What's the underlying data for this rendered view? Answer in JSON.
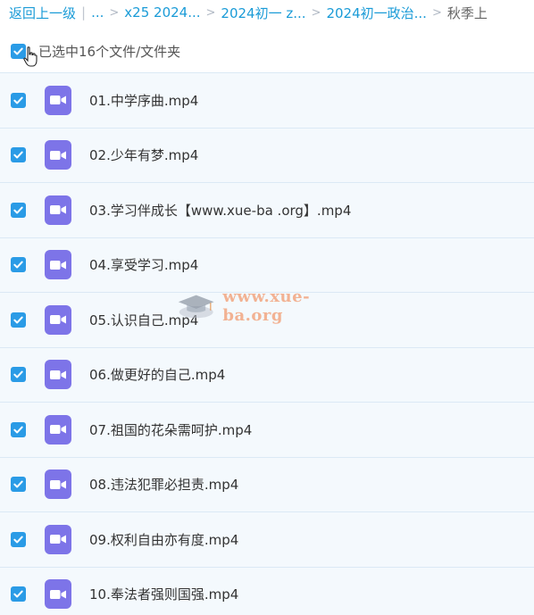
{
  "breadcrumb": {
    "back": "返回上一级",
    "ellipsis": "...",
    "items": [
      "x25 2024...",
      "2024初一 z...",
      "2024初一政治..."
    ],
    "current": "秋季上"
  },
  "selection": {
    "label": "已选中16个文件/文件夹",
    "checked": true
  },
  "files": [
    {
      "name": "01.中学序曲.mp4",
      "checked": true
    },
    {
      "name": "02.少年有梦.mp4",
      "checked": true
    },
    {
      "name": "03.学习伴成长【www.xue-ba .org】.mp4",
      "checked": true
    },
    {
      "name": "04.享受学习.mp4",
      "checked": true
    },
    {
      "name": "05.认识自己.mp4",
      "checked": true
    },
    {
      "name": "06.做更好的自己.mp4",
      "checked": true
    },
    {
      "name": "07.祖国的花朵需呵护.mp4",
      "checked": true
    },
    {
      "name": "08.违法犯罪必担责.mp4",
      "checked": true
    },
    {
      "name": "09.权利自由亦有度.mp4",
      "checked": true
    },
    {
      "name": "10.奉法者强则国强.mp4",
      "checked": true
    }
  ],
  "file_icon": "video-file-icon",
  "watermark": {
    "text": "www.xue-ba.org"
  },
  "colors": {
    "link": "#1a9bd7",
    "checkbox": "#2a9be6",
    "row_bg": "#f4f9fd",
    "video_icon": "#7d74e8"
  }
}
